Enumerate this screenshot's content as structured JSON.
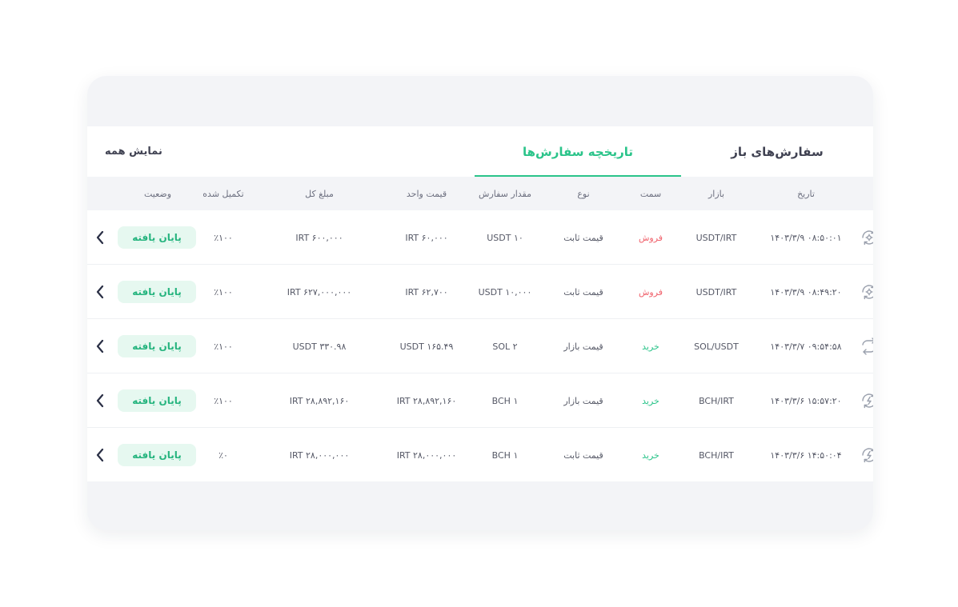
{
  "tabs": {
    "open_orders": "سفارش‌های باز",
    "order_history": "تاریخچه سفارش‌ها",
    "show_all": "نمایش همه"
  },
  "table": {
    "headers": [
      "تاریخ",
      "بازار",
      "سمت",
      "نوع",
      "مقدار سفارش",
      "قیمت واحد",
      "مبلغ کل",
      "تکمیل شده",
      "وضعیت"
    ],
    "rows": [
      {
        "icon": "settings-refresh-icon",
        "date": "۱۴۰۳/۳/۹ ۰۸:۵۰:۰۱",
        "market": "USDT/IRT",
        "side": "فروش",
        "side_kind": "sell",
        "type": "قیمت ثابت",
        "amount": "USDT ۱۰",
        "unit_price": "IRT ۶۰,۰۰۰",
        "total": "IRT ۶۰۰,۰۰۰",
        "filled": "٪۱۰۰",
        "status": "پایان یافته"
      },
      {
        "icon": "settings-refresh-icon",
        "date": "۱۴۰۳/۳/۹ ۰۸:۴۹:۲۰",
        "market": "USDT/IRT",
        "side": "فروش",
        "side_kind": "sell",
        "type": "قیمت ثابت",
        "amount": "USDT ۱۰,۰۰۰",
        "unit_price": "IRT ۶۲,۷۰۰",
        "total": "IRT ۶۲۷,۰۰۰,۰۰۰",
        "filled": "٪۱۰۰",
        "status": "پایان یافته"
      },
      {
        "icon": "swap-arrows-icon",
        "date": "۱۴۰۳/۳/۷ ۰۹:۵۴:۵۸",
        "market": "SOL/USDT",
        "side": "خرید",
        "side_kind": "buy",
        "type": "قیمت بازار",
        "amount": "SOL ۲",
        "unit_price": "USDT ۱۶۵.۴۹",
        "total": "USDT ۳۳۰.۹۸",
        "filled": "٪۱۰۰",
        "status": "پایان یافته"
      },
      {
        "icon": "lightning-refresh-icon",
        "date": "۱۴۰۳/۳/۶ ۱۵:۵۷:۲۰",
        "market": "BCH/IRT",
        "side": "خرید",
        "side_kind": "buy",
        "type": "قیمت بازار",
        "amount": "BCH ۱",
        "unit_price": "IRT ۲۸,۸۹۲,۱۶۰",
        "total": "IRT ۲۸,۸۹۲,۱۶۰",
        "filled": "٪۱۰۰",
        "status": "پایان یافته"
      },
      {
        "icon": "lightning-refresh-icon",
        "date": "۱۴۰۳/۳/۶ ۱۴:۵۰:۰۴",
        "market": "BCH/IRT",
        "side": "خرید",
        "side_kind": "buy",
        "type": "قیمت ثابت",
        "amount": "BCH ۱",
        "unit_price": "IRT ۲۸,۰۰۰,۰۰۰",
        "total": "IRT ۲۸,۰۰۰,۰۰۰",
        "filled": "٪۰",
        "status": "پایان یافته"
      }
    ]
  },
  "colors": {
    "accent": "#2bc48a",
    "sell": "#f0636d",
    "buy": "#2bc48a",
    "badge_bg": "#e6f8f0"
  }
}
